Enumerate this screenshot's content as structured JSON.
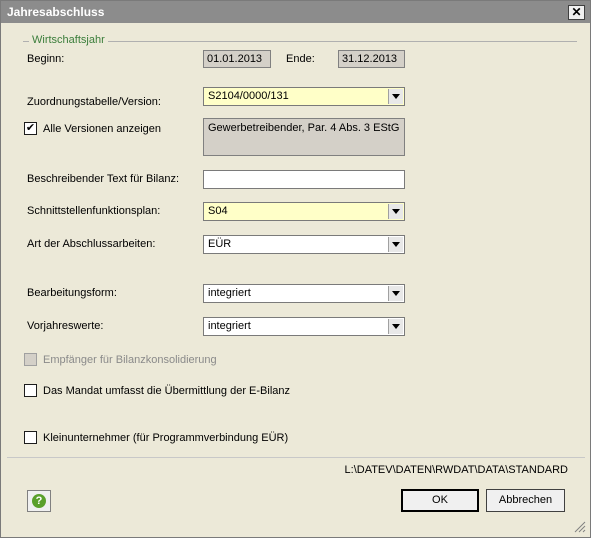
{
  "window": {
    "title": "Jahresabschluss",
    "close_glyph": "✕"
  },
  "group": {
    "label": "Wirtschaftsjahr"
  },
  "fiscal_year": {
    "begin_label": "Beginn:",
    "begin_value": "01.01.2013",
    "end_label": "Ende:",
    "end_value": "31.12.2013"
  },
  "mapping": {
    "label": "Zuordnungstabelle/Version:",
    "value": "S2104/0000/131",
    "show_all_label": "Alle Versionen anzeigen",
    "show_all_checked": "✔",
    "description": "Gewerbetreibender, Par. 4 Abs. 3 EStG"
  },
  "bilanz_text": {
    "label": "Beschreibender Text für Bilanz:",
    "value": ""
  },
  "interface_plan": {
    "label": "Schnittstellenfunktionsplan:",
    "value": "S04"
  },
  "closing_type": {
    "label": "Art der Abschlussarbeiten:",
    "value": "EÜR"
  },
  "processing": {
    "label": "Bearbeitungsform:",
    "value": "integriert"
  },
  "prior_year": {
    "label": "Vorjahreswerte:",
    "value": "integriert"
  },
  "checkboxes": {
    "consolidation": "Empfänger für Bilanzkonsolidierung",
    "ebilanz": "Das Mandat umfasst die Übermittlung der E-Bilanz",
    "small_business": "Kleinunternehmer (für Programmverbindung EÜR)"
  },
  "path": "L:\\DATEV\\DATEN\\RWDAT\\DATA\\STANDARD",
  "buttons": {
    "help_glyph": "?",
    "ok": "OK",
    "cancel": "Abbrechen"
  },
  "icons": {
    "help": "help-icon",
    "close": "close-icon",
    "dropdown": "chevron-down-icon",
    "grip": "resize-grip-icon"
  },
  "colors": {
    "required_field": "#ffffc8",
    "readonly_field": "#d4d0c8",
    "group_label": "#3a7d3a",
    "titlebar": "#8c8c8c"
  }
}
